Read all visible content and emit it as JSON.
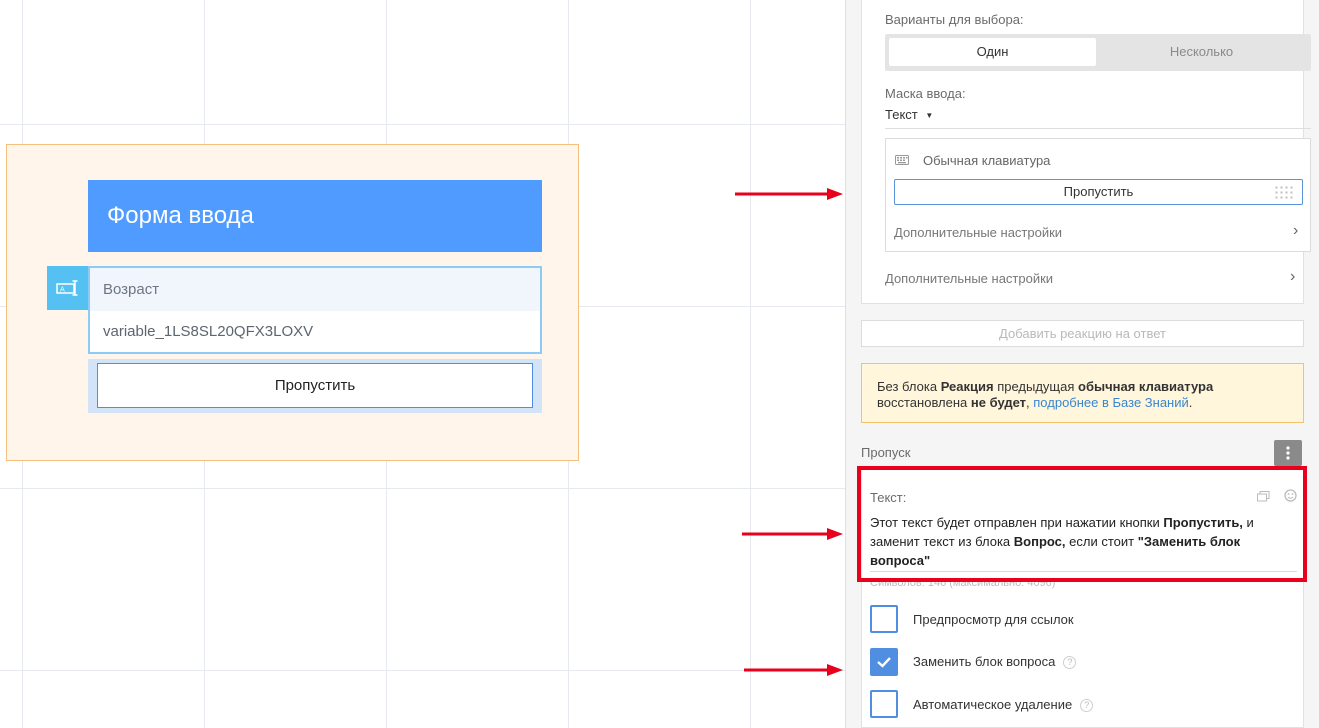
{
  "canvas": {
    "block_title": "Форма ввода",
    "field_label": "Возраст",
    "field_variable": "variable_1LS8SL20QFX3LOXV",
    "skip_button": "Пропустить"
  },
  "panel": {
    "choice_label": "Варианты для выбора:",
    "choice_options": [
      "Один",
      "Несколько"
    ],
    "choice_selected": "Один",
    "mask_label": "Маска ввода:",
    "mask_value": "Текст",
    "keyboard_title": "Обычная клавиатура",
    "keyboard_button": "Пропустить",
    "keyboard_more": "Дополнительные настройки",
    "card_more": "Дополнительные настройки",
    "add_reaction": "Добавить реакцию на ответ",
    "warning": {
      "t1": "Без блока ",
      "b1": "Реакция",
      "t2": " предыдущая ",
      "b2": "обычная клавиатура",
      "t3": " восстановлена ",
      "b3": "не будет",
      "t4": ", ",
      "link": "подробнее в Базе Знаний",
      "t5": "."
    },
    "skip_section": "Пропуск",
    "text_label": "Текст:",
    "text_body": {
      "t1": "Этот текст будет отправлен при нажатии кнопки ",
      "b1": "Пропустить,",
      "t2": " и заменит текст из блока ",
      "b2": "Вопрос,",
      "t3": " если стоит ",
      "b3": "\"Заменить блок вопроса\""
    },
    "counter": "Символов: 146 (максимально: 4096)",
    "checkboxes": [
      {
        "label": "Предпросмотр для ссылок",
        "checked": false
      },
      {
        "label": "Заменить блок вопроса",
        "checked": true
      },
      {
        "label": "Автоматическое удаление",
        "checked": false
      }
    ]
  },
  "colors": {
    "accent": "#4f9bff",
    "highlight_red": "#e8001c",
    "warning_bg": "#fff6dc"
  },
  "icons": [
    "input-field-icon",
    "keyboard-icon",
    "chevron-right-icon",
    "dots-vertical-icon",
    "gallery-icon",
    "emoji-icon",
    "check-icon",
    "help-icon",
    "red-arrow"
  ]
}
